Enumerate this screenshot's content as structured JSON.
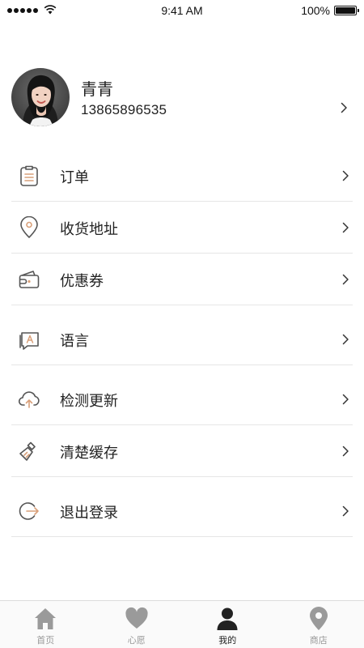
{
  "status_bar": {
    "time": "9:41 AM",
    "battery": "100%",
    "signal_icon": "signal-dots-icon",
    "wifi_icon": "wifi-icon",
    "battery_icon": "battery-full-icon",
    "battery_level": 1.0
  },
  "profile": {
    "name": "青青",
    "phone": "13865896535",
    "avatar_icon": "user-avatar-photo",
    "chevron_icon": "chevron-right-icon"
  },
  "menu": {
    "items": [
      {
        "label": "订单",
        "icon": "clipboard-list-icon"
      },
      {
        "label": "收货地址",
        "icon": "location-pin-icon"
      },
      {
        "label": "优惠券",
        "icon": "wallet-icon"
      },
      {
        "label": "语言",
        "icon": "language-icon"
      },
      {
        "label": "检测更新",
        "icon": "cloud-upload-icon"
      },
      {
        "label": "清楚缓存",
        "icon": "broom-icon"
      },
      {
        "label": "退出登录",
        "icon": "logout-icon"
      }
    ]
  },
  "tabbar": {
    "tabs": [
      {
        "label": "首页",
        "icon": "home-icon",
        "active": false
      },
      {
        "label": "心愿",
        "icon": "heart-icon",
        "active": false
      },
      {
        "label": "我的",
        "icon": "person-icon",
        "active": true
      },
      {
        "label": "商店",
        "icon": "map-pin-icon",
        "active": false
      }
    ]
  },
  "colors": {
    "accent": "#d9a07a",
    "icon_gray": "#555555",
    "divider": "#e6e6e6",
    "tab_inactive": "#9a9a9a",
    "tab_active": "#222222"
  }
}
